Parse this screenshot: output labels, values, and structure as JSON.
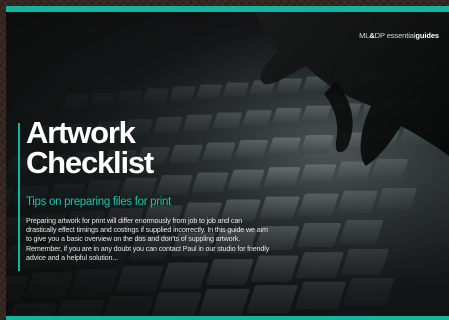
{
  "brand": {
    "prefix": "ML",
    "ampersand": "&",
    "mid": "DP essential",
    "suffix": "guides"
  },
  "title": {
    "line1": "Artwork",
    "line2": "Checklist"
  },
  "subtitle": "Tips on preparing files for print",
  "intro": "Preparing artwork for print will differ enormously from job to job and can drastically effect timings and costings if supplied incorrectly. In this guide we aim to give you a basic overview on the dos and don'ts of suppling artwork. Remember, if you are in any doubt you can contact Paul in our studio for friendly advice and a helpful solution...",
  "colors": {
    "accent": "#12b5a0",
    "background": "#0b0c0c",
    "wood_border": "#33251c"
  }
}
